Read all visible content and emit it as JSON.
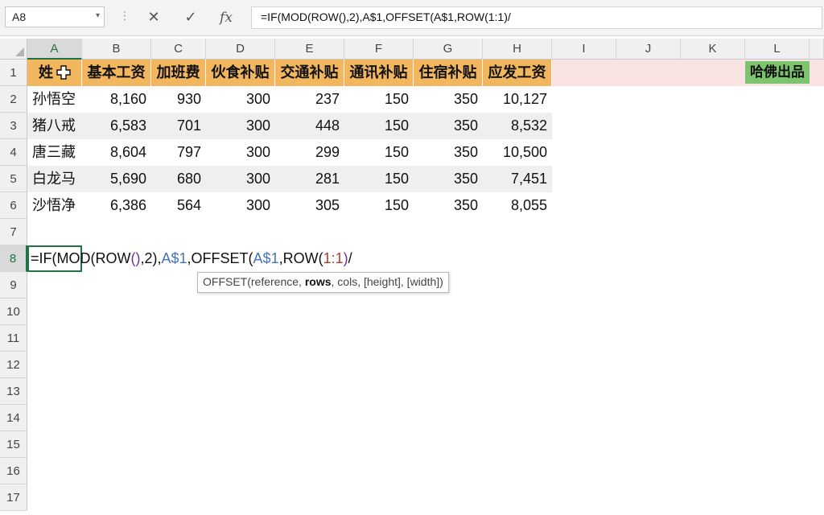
{
  "formula_bar": {
    "name_box": "A8",
    "cancel_icon": "✕",
    "enter_icon": "✓",
    "fx_label": "fx",
    "formula": "=IF(MOD(ROW(),2),A$1,OFFSET(A$1,ROW(1:1)/"
  },
  "columns": [
    "A",
    "B",
    "C",
    "D",
    "E",
    "F",
    "G",
    "H",
    "I",
    "J",
    "K",
    "L"
  ],
  "rows": [
    "1",
    "2",
    "3",
    "4",
    "5",
    "6",
    "7",
    "8",
    "9",
    "10",
    "11",
    "12",
    "13",
    "14",
    "15",
    "16",
    "17"
  ],
  "selected_cell": "A8",
  "table": {
    "headers": [
      "姓名",
      "基本工资",
      "加班费",
      "伙食补贴",
      "交通补贴",
      "通讯补贴",
      "住宿补贴",
      "应发工资"
    ],
    "header_visible_text": "姓",
    "rows": [
      [
        "孙悟空",
        "8,160",
        "930",
        "300",
        "237",
        "150",
        "350",
        "10,127"
      ],
      [
        "猪八戒",
        "6,583",
        "701",
        "300",
        "448",
        "150",
        "350",
        "8,532"
      ],
      [
        "唐三藏",
        "8,604",
        "797",
        "300",
        "299",
        "150",
        "350",
        "10,500"
      ],
      [
        "白龙马",
        "5,690",
        "680",
        "300",
        "281",
        "150",
        "350",
        "7,451"
      ],
      [
        "沙悟净",
        "6,386",
        "564",
        "300",
        "305",
        "150",
        "350",
        "8,055"
      ]
    ]
  },
  "label_L1": "哈佛出品",
  "edit_formula_parts": [
    {
      "text": "=IF(MOD(",
      "color": "default"
    },
    {
      "text": "ROW",
      "color": "default"
    },
    {
      "text": "()",
      "color": "purple"
    },
    {
      "text": ",2),",
      "color": "default"
    },
    {
      "text": "A$1",
      "color": "blue"
    },
    {
      "text": ",OFFSET(",
      "color": "default"
    },
    {
      "text": "A$1",
      "color": "blue"
    },
    {
      "text": ",ROW(",
      "color": "default"
    },
    {
      "text": "1:1",
      "color": "red"
    },
    {
      "text": ")",
      "color": "purple"
    },
    {
      "text": "/",
      "color": "default"
    }
  ],
  "tooltip": {
    "func": "OFFSET(",
    "arg_ref": "reference",
    "sep1": ", ",
    "arg_rows": "rows",
    "rest": ", cols, [height], [width])"
  },
  "colors": {
    "header_fill": "#f2b75e",
    "band_fill": "#efefef",
    "label_fill": "#7dc46e",
    "row1_pink": "#f9e3e3",
    "selection": "#217346",
    "ref_blue": "#4472c4",
    "ref_red": "#b03a2e",
    "ref_purple": "#7030a0"
  }
}
